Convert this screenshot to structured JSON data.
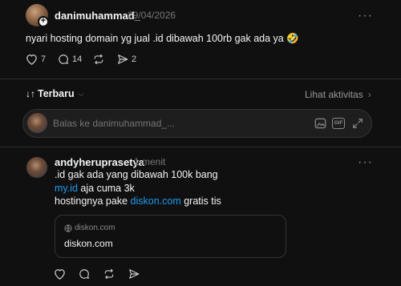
{
  "post": {
    "username": "danimuhammad_",
    "date": "29/04/2026",
    "text": "nyari hosting domain yg jual .id dibawah 100rb gak ada ya 🤣",
    "likes": "7",
    "comments": "14",
    "shares": "2"
  },
  "replies_header": {
    "sort_label": "Terbaru",
    "activity_label": "Lihat aktivitas"
  },
  "reply_input": {
    "placeholder": "Balas ke danimuhammad_..."
  },
  "reply": {
    "username": "andyheruprasetya",
    "time": "1 menit",
    "line1": ".id gak ada yang dibawah 100k bang",
    "line2_link": "my.id",
    "line2_rest": " aja cuma 3k",
    "line3_prefix": "hostingnya pake ",
    "line3_link": "diskon.com",
    "line3_rest": " gratis tis",
    "card_domain": "diskon.com",
    "card_title": "diskon.com"
  },
  "icons": {
    "heart": "heart-icon",
    "comment": "comment-icon",
    "repost": "repost-icon",
    "share": "share-icon",
    "globe": "globe-icon"
  },
  "colors": {
    "background": "#101010",
    "link": "#1d9bf0",
    "text": "#f3f5f7",
    "muted": "#777777"
  }
}
